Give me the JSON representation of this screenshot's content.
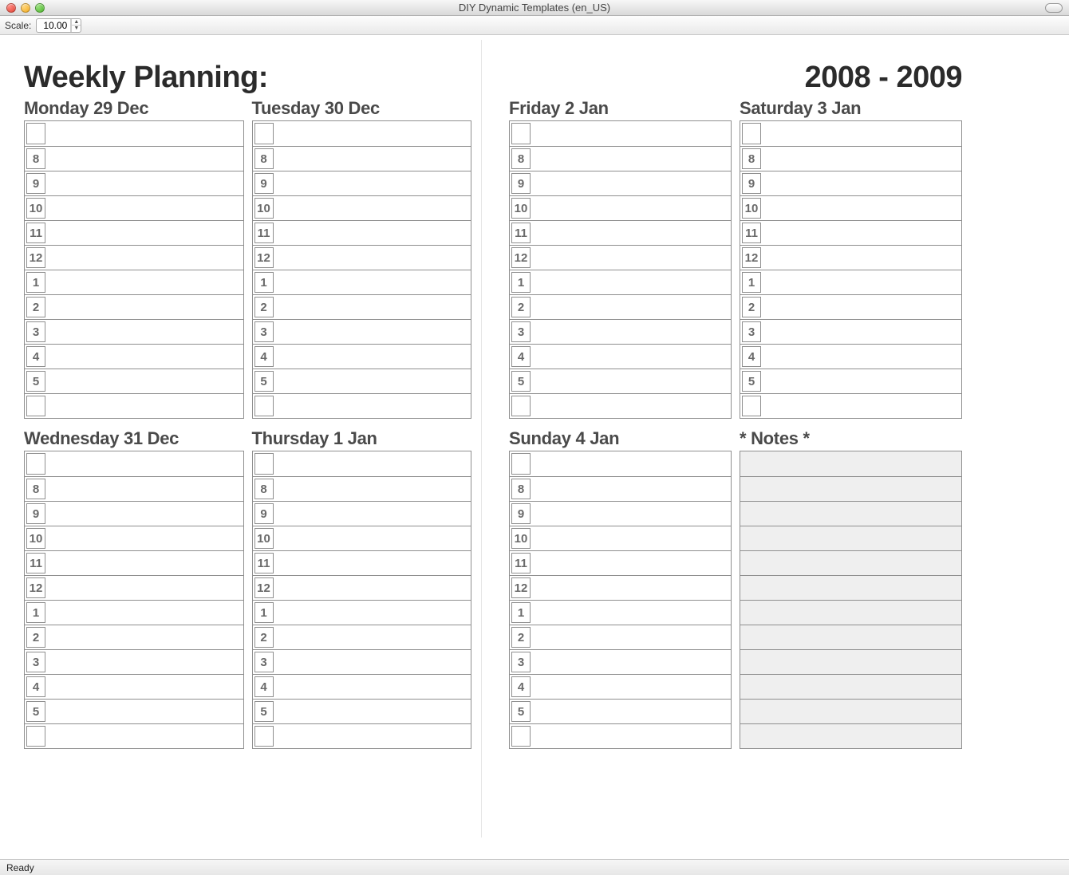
{
  "window": {
    "title": "DIY Dynamic Templates (en_US)"
  },
  "toolbar": {
    "scale_label": "Scale:",
    "scale_value": "10.00"
  },
  "planner": {
    "title": "Weekly Planning:",
    "year_range": "2008 - 2009",
    "notes_label": "* Notes *",
    "hours": [
      "",
      "8",
      "9",
      "10",
      "11",
      "12",
      "1",
      "2",
      "3",
      "4",
      "5",
      ""
    ],
    "days_left": [
      {
        "label": "Monday 29 Dec"
      },
      {
        "label": "Tuesday 30 Dec"
      },
      {
        "label": "Wednesday 31 Dec"
      },
      {
        "label": "Thursday 1 Jan"
      }
    ],
    "days_right": [
      {
        "label": "Friday 2 Jan"
      },
      {
        "label": "Saturday 3 Jan"
      },
      {
        "label": "Sunday 4 Jan"
      }
    ]
  },
  "status": {
    "text": "Ready"
  }
}
